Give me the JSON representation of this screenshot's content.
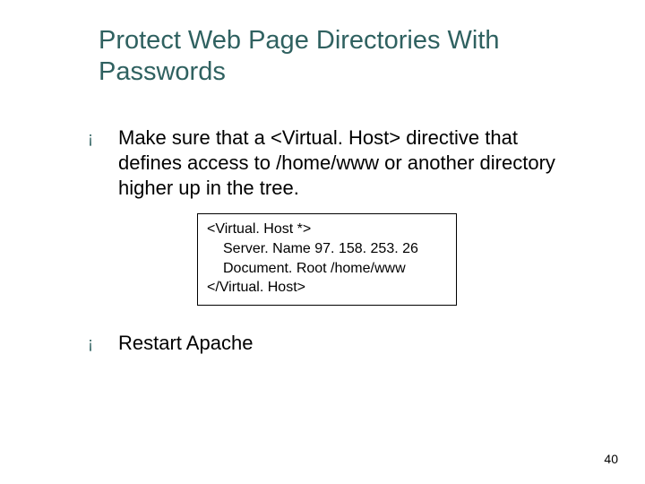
{
  "slide": {
    "title": "Protect Web Page Directories With Passwords",
    "bullets": [
      {
        "marker": "¡",
        "text": "Make sure that a <Virtual. Host> directive that defines access to /home/www or another directory higher up in the tree."
      },
      {
        "marker": "¡",
        "text": "Restart Apache"
      }
    ],
    "code": {
      "line1": "<Virtual. Host *>",
      "line2": "Server. Name 97. 158. 253. 26",
      "line3": "Document. Root /home/www",
      "line4": "</Virtual. Host>"
    },
    "page_number": "40"
  }
}
